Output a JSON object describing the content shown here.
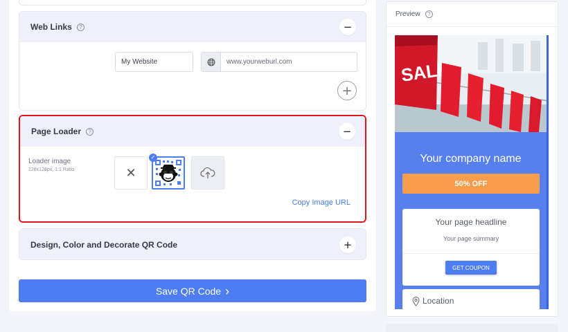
{
  "web_links": {
    "title": "Web Links",
    "toggle": "−",
    "name_value": "My Website",
    "url_placeholder": "www.yourweburl.com",
    "add": "+"
  },
  "page_loader": {
    "title": "Page Loader",
    "toggle": "−",
    "loader_label": "Loader image",
    "loader_sub": "128x128px, 1:1 Ratio",
    "copy_url": "Copy Image URL",
    "selected_option": "logo"
  },
  "design": {
    "title": "Design, Color and Decorate QR Code",
    "toggle": "+"
  },
  "save": {
    "label": "Save QR Code",
    "chevron": "›"
  },
  "preview": {
    "title": "Preview",
    "hero_sign": "SALE",
    "company_name": "Your company name",
    "offer": "50% OFF",
    "headline": "Your page headline",
    "summary": "Your page summary",
    "coupon": "GET COUPON",
    "location": "Location"
  },
  "colors": {
    "accent": "#4e7df2",
    "offer": "#f89d4c",
    "highlight_border": "#e0161d",
    "section_head": "#eff0fb"
  }
}
